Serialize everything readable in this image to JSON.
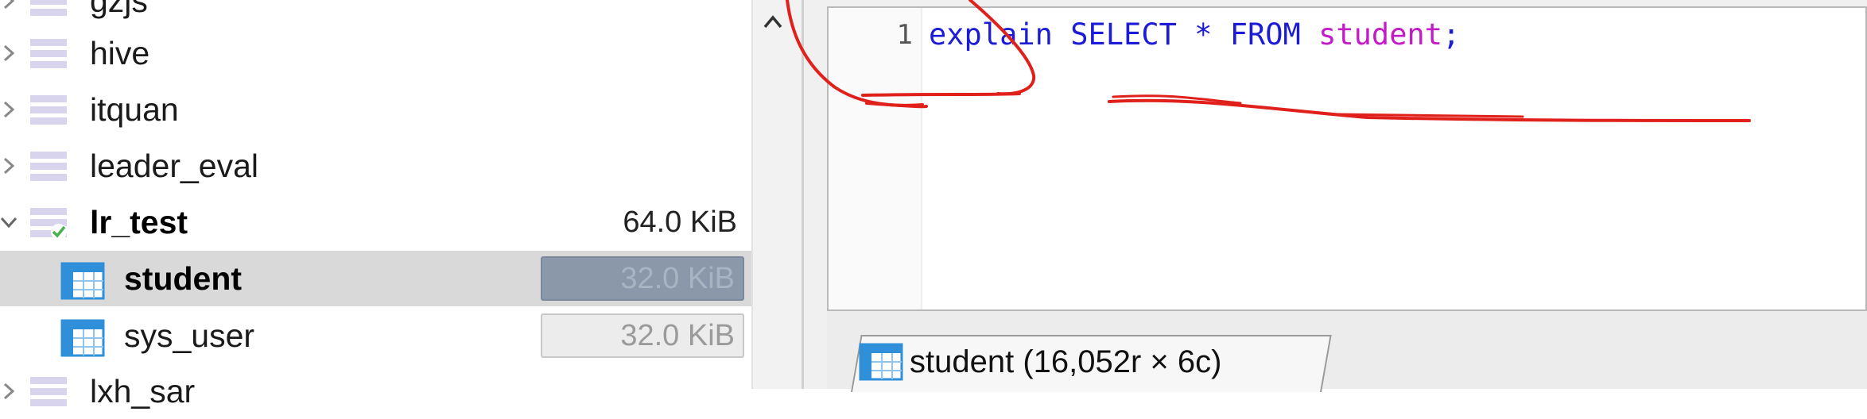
{
  "tree": {
    "items": [
      {
        "label": "gzjs",
        "kind": "database",
        "expanded": false
      },
      {
        "label": "hive",
        "kind": "database",
        "expanded": false
      },
      {
        "label": "itquan",
        "kind": "database",
        "expanded": false
      },
      {
        "label": "leader_eval",
        "kind": "database",
        "expanded": false
      },
      {
        "label": "lr_test",
        "kind": "database",
        "expanded": true,
        "size": "64.0 KiB"
      },
      {
        "label": "student",
        "kind": "table",
        "size": "32.0 KiB",
        "selected": true
      },
      {
        "label": "sys_user",
        "kind": "table",
        "size": "32.0 KiB"
      },
      {
        "label": "lxh_sar",
        "kind": "database",
        "expanded": false
      }
    ]
  },
  "editor": {
    "line_number": "1",
    "tokens": {
      "explain": "explain",
      "select": "SELECT",
      "star": "*",
      "from": "FROM",
      "table": "student",
      "semicolon": ";"
    }
  },
  "result_tab": {
    "label": "student (16,052r × 6c)"
  },
  "colors": {
    "keyword": "#1c1cd6",
    "identifier": "#c21bc7",
    "selection_bg": "#d9d9d9",
    "annotation": "#e0201b"
  }
}
